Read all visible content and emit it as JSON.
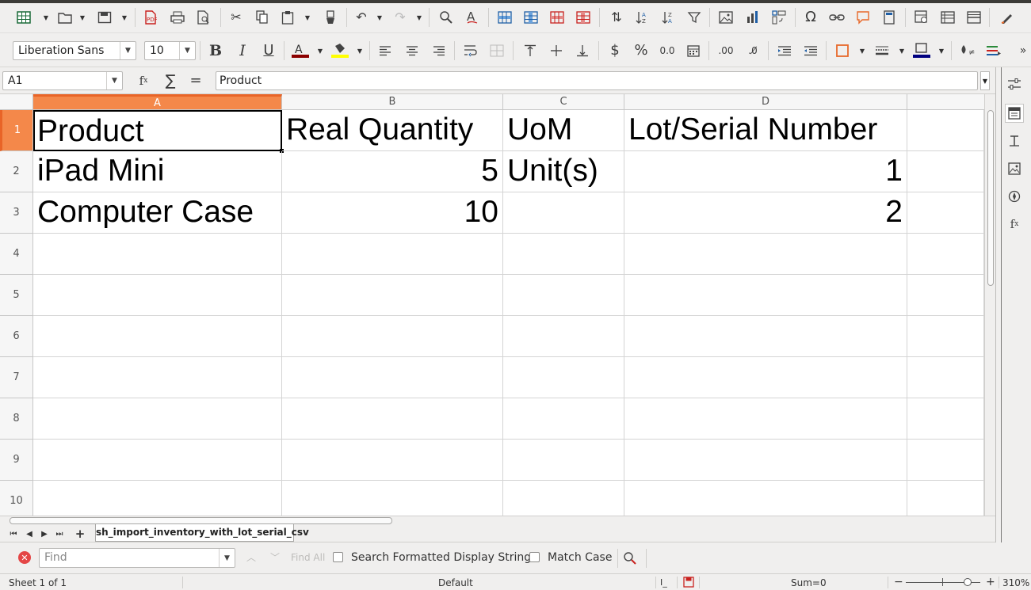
{
  "toolbar1": {
    "icons": [
      "new-spreadsheet-icon",
      "open-folder-icon",
      "save-icon",
      "export-pdf-icon",
      "print-icon",
      "print-preview-icon",
      "cut-icon",
      "copy-icon",
      "paste-icon",
      "clone-formatting-icon",
      "undo-icon",
      "redo-icon",
      "find-replace-icon",
      "spellcheck-icon",
      "row-icon",
      "column-icon",
      "insert-cells-icon",
      "delete-cells-icon",
      "sort-icon",
      "sort-ascending-icon",
      "sort-descending-icon",
      "autofilter-icon",
      "insert-image-icon",
      "insert-chart-icon",
      "pivot-table-icon",
      "special-character-icon",
      "hyperlink-icon",
      "comment-icon",
      "headers-footers-icon",
      "define-print-area-icon",
      "freeze-rows-columns-icon",
      "split-window-icon",
      "show-draw-functions-icon"
    ]
  },
  "toolbar2": {
    "font_name": "Liberation Sans",
    "font_size": "10",
    "font_color": "#8b0000",
    "highlight_color": "#ffff00",
    "border_color": "#000080"
  },
  "formula_bar": {
    "cell_ref": "A1",
    "content": "Product"
  },
  "columns": [
    "A",
    "B",
    "C",
    "D"
  ],
  "rows": [
    "1",
    "2",
    "3",
    "4",
    "5",
    "6",
    "7",
    "8",
    "9",
    "10"
  ],
  "table": {
    "r1": {
      "a": "Product",
      "b": "Real Quantity",
      "c": "UoM",
      "d": "Lot/Serial Number"
    },
    "r2": {
      "a": "iPad Mini",
      "b": "5",
      "c": "Unit(s)",
      "d": "1"
    },
    "r3": {
      "a": "Computer Case",
      "b": "10",
      "c": "",
      "d": "2"
    }
  },
  "sheet_tab": "sh_import_inventory_with_lot_serial_csv",
  "find_bar": {
    "placeholder": "Find",
    "find_all": "Find All",
    "search_formatted": "Search Formatted Display String",
    "match_case": "Match Case"
  },
  "status": {
    "sheet": "Sheet 1 of 1",
    "page_style": "Default",
    "sum": "Sum=0",
    "zoom": "310%"
  }
}
